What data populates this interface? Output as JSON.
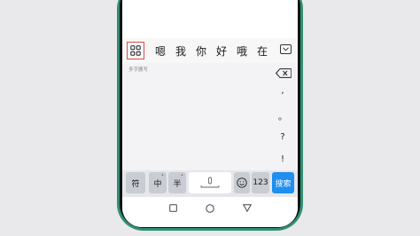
{
  "candidate_bar": {
    "candidates": [
      "嗯",
      "我",
      "你",
      "好",
      "哦",
      "在"
    ]
  },
  "handwriting": {
    "hint": "多字搬写",
    "punctuation": [
      ",",
      "。",
      "?",
      "!"
    ]
  },
  "bottom_row": {
    "symbol_key": "符",
    "chinese_key": "中",
    "half_key": "半",
    "number_key": "123",
    "search_key": "搜索"
  },
  "icons": {
    "grid": "grid-icon",
    "collapse": "chevron-down-icon",
    "backspace": "backspace-icon",
    "mic": "mic-icon",
    "emoji": "emoji-icon",
    "nav_recent": "square-icon",
    "nav_home": "circle-icon",
    "nav_back": "triangle-icon"
  },
  "colors": {
    "phone_frame": "#2f8f73",
    "search_key": "#1f8ff0",
    "grid_highlight": "#e14c4c"
  }
}
